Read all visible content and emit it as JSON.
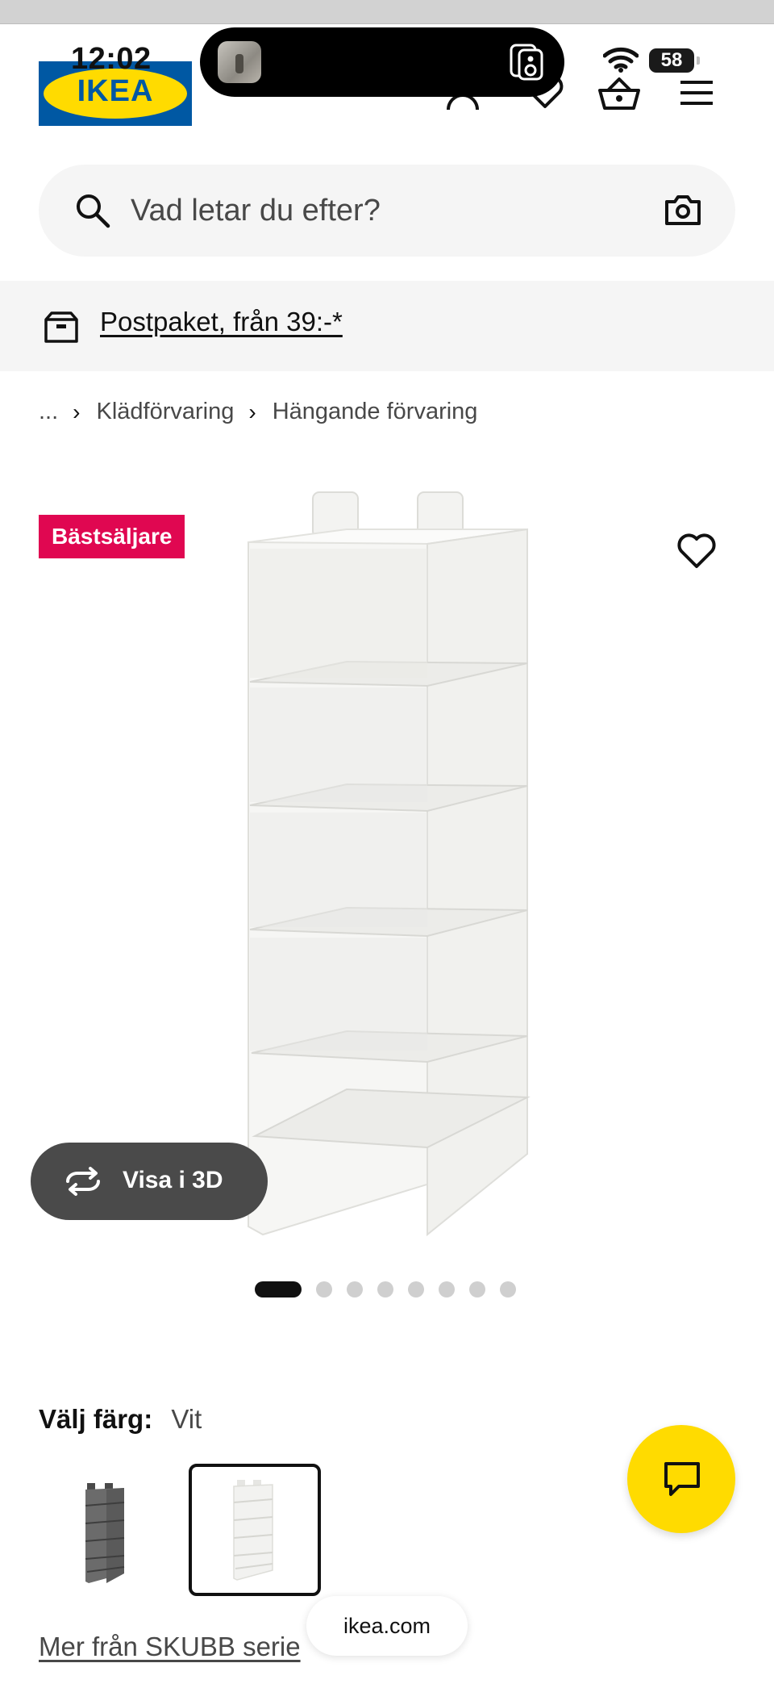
{
  "status_bar": {
    "time": "12:02",
    "battery": "58"
  },
  "header": {
    "logo_text": "IKEA",
    "colors": {
      "logo_blue": "#0058a3",
      "logo_yellow": "#ffdb00"
    },
    "icons": [
      "user-icon",
      "heart-icon",
      "basket-icon",
      "menu-icon"
    ]
  },
  "search": {
    "placeholder": "Vad letar du efter?"
  },
  "delivery_banner": {
    "text": "Postpaket, från 39:-*"
  },
  "breadcrumb": {
    "items": [
      "...",
      "Klädförvaring",
      "Hängande förvaring"
    ]
  },
  "product_media": {
    "badge": "Bästsäljare",
    "badge_color": "#e00751",
    "view_3d_label": "Visa i 3D",
    "gallery": {
      "total": 8,
      "active": 1
    }
  },
  "color_select": {
    "label": "Välj färg:",
    "value": "Vit",
    "options": [
      "Grå",
      "Vit"
    ],
    "selected_index": 1
  },
  "more_link": "Mer från SKUBB serie",
  "browser": {
    "url": "ikea.com"
  },
  "chat_button_color": "#ffdb00"
}
